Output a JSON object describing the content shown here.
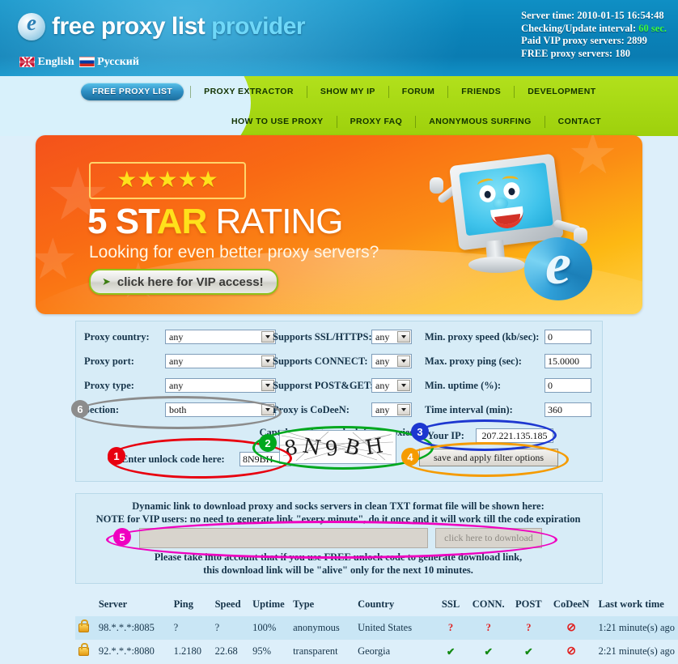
{
  "header": {
    "logo_text_1": "free proxy list ",
    "logo_text_2": "provider",
    "logo_icon": "ie-e-icon",
    "languages": [
      {
        "label": "English",
        "flag": "uk-flag-icon"
      },
      {
        "label": "Русский",
        "flag": "ru-flag-icon"
      }
    ],
    "server_info": {
      "server_time_label": "Server time:",
      "server_time_value": "2010-01-15 16:54:48",
      "interval_label": "Checking/Update interval:",
      "interval_value": "60 sec.",
      "paid_label": "Paid VIP proxy servers:",
      "paid_value": "2899",
      "free_label": "FREE proxy servers:",
      "free_value": "180"
    }
  },
  "nav": {
    "row1": [
      "FREE PROXY LIST",
      "PROXY EXTRACTOR",
      "SHOW MY IP",
      "FORUM",
      "FRIENDS",
      "DEVELOPMENT"
    ],
    "row2": [
      "HOW TO USE PROXY",
      "PROXY FAQ",
      "ANONYMOUS SURFING",
      "CONTACT"
    ],
    "active": "FREE PROXY LIST"
  },
  "banner": {
    "stars": "★★★★★",
    "title_num": "5 ",
    "title_st": "ST",
    "title_ar": "AR",
    "title_rating": " RATING",
    "subtitle": "Looking for even better proxy servers?",
    "button_label": "click here for VIP access!",
    "button_arrow": "➤"
  },
  "filters": {
    "left": [
      {
        "label": "Proxy country:",
        "value": "any"
      },
      {
        "label": "Proxy port:",
        "value": "any"
      },
      {
        "label": "Proxy type:",
        "value": "any"
      },
      {
        "label": "Section:",
        "value": "both"
      }
    ],
    "middle": [
      {
        "label": "Supports SSL/HTTPS:",
        "value": "any"
      },
      {
        "label": "Supports CONNECT:",
        "value": "any"
      },
      {
        "label": "Supporst POST&GET:",
        "value": "any"
      },
      {
        "label": "Proxy is CoDeeN:",
        "value": "any"
      }
    ],
    "right": [
      {
        "label": "Min. proxy speed (kb/sec):",
        "value": "0"
      },
      {
        "label": "Max. proxy ping (sec):",
        "value": "15.0000"
      },
      {
        "label": "Min. uptime (%):",
        "value": "0"
      },
      {
        "label": "Time interval (min):",
        "value": "360"
      }
    ],
    "captcha_caption": "Captcha code to unlock free proxies:",
    "unlock_label": "Enter unlock code here:",
    "unlock_value": "8N9BH",
    "captcha_alt": "captcha-image",
    "your_ip_label": "Your IP:",
    "your_ip_value": "207.221.135.185",
    "apply_button": "save and apply filter options"
  },
  "annotations": [
    {
      "number": "1",
      "color": "#e8000f",
      "target": "unlock-code-row"
    },
    {
      "number": "2",
      "color": "#00a81e",
      "target": "captcha-image"
    },
    {
      "number": "3",
      "color": "#1d37d0",
      "target": "your-ip-row"
    },
    {
      "number": "4",
      "color": "#f59b00",
      "target": "apply-filter-button"
    },
    {
      "number": "5",
      "color": "#ef00c0",
      "target": "download-link-row"
    },
    {
      "number": "6",
      "color": "#8c8c8c",
      "target": "section-select-row"
    }
  ],
  "download": {
    "line1": "Dynamic link to download proxy and socks servers in clean TXT format file will be shown here:",
    "line2": "NOTE for VIP users: no need to generate link \"every minute\", do it once and it will work till the code expiration",
    "input_value": "",
    "button_label": "click here to download",
    "note1": "Please take into account that if you use FREE unlock code to generate download link,",
    "note2": "this download link will be \"alive\" only for the next 10 minutes."
  },
  "table": {
    "columns": [
      "Server",
      "Ping",
      "Speed",
      "Uptime",
      "Type",
      "Country",
      "SSL",
      "CONN.",
      "POST",
      "CoDeeN",
      "Last work time"
    ],
    "rows": [
      {
        "lock": "lock-icon",
        "server": "98.*.*.*:8085",
        "ping": "?",
        "speed": "?",
        "uptime": "100%",
        "type": "anonymous",
        "country": "United States",
        "ssl": "?",
        "ssl_state": "unknown",
        "conn": "?",
        "conn_state": "unknown",
        "post": "?",
        "post_state": "unknown",
        "codeen": "⊘",
        "codeen_state": "no",
        "last": "1:21 minute(s) ago"
      },
      {
        "lock": "lock-icon",
        "server": "92.*.*.*:8080",
        "ping": "1.2180",
        "speed": "22.68",
        "uptime": "95%",
        "type": "transparent",
        "country": "Georgia",
        "ssl": "✔",
        "ssl_state": "yes",
        "conn": "✔",
        "conn_state": "yes",
        "post": "✔",
        "post_state": "yes",
        "codeen": "⊘",
        "codeen_state": "no",
        "last": "2:21 minute(s) ago"
      }
    ]
  },
  "colors": {
    "header_blue": "#0a82b8",
    "nav_green": "#a6d813",
    "panel_blue": "#d7ecf7",
    "page_bg": "#ddeffa",
    "banner_orange": "#fb8c14",
    "accent_cyan": "#6fd8f8",
    "ok_green": "#138a13",
    "alert_red": "#e02020"
  }
}
